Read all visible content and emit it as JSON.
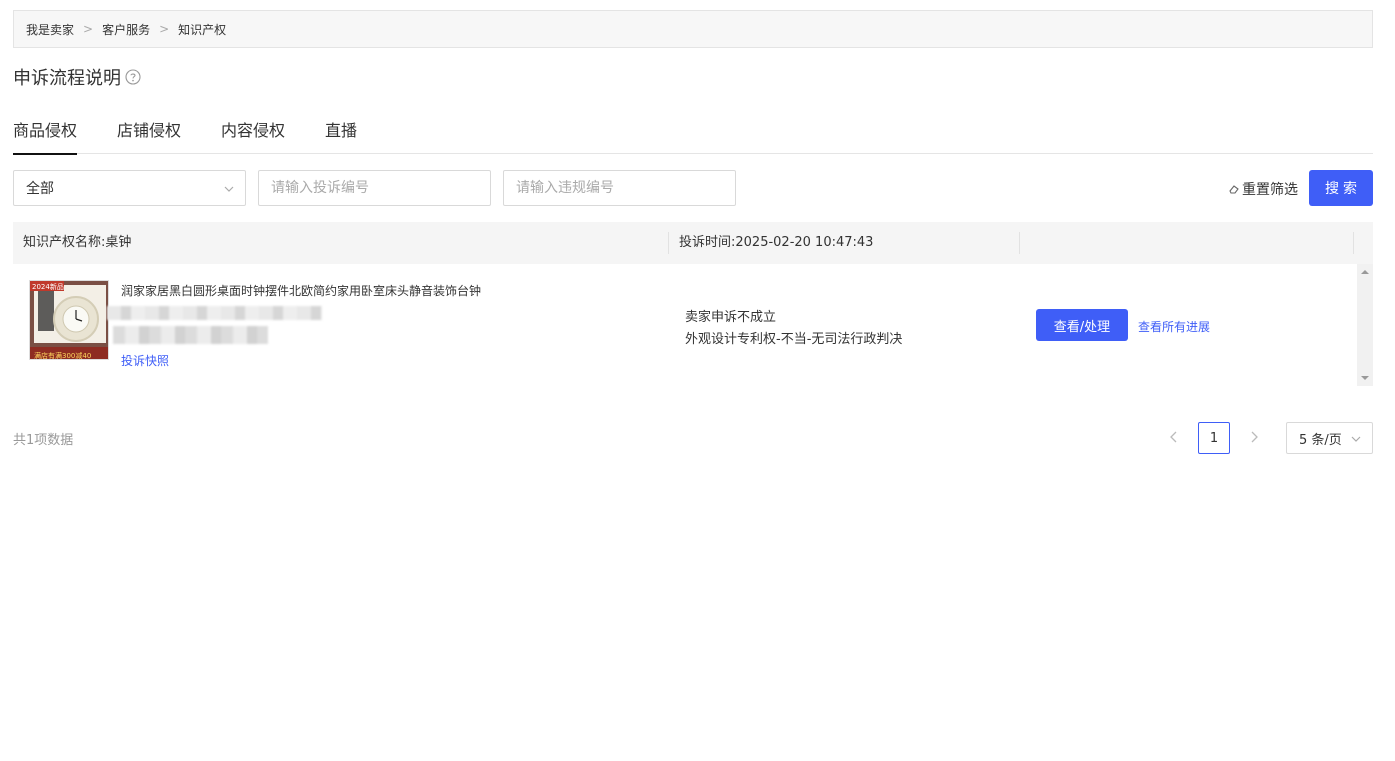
{
  "breadcrumb": {
    "items": [
      "我是卖家",
      "客户服务",
      "知识产权"
    ],
    "separator": ">"
  },
  "page": {
    "title": "申诉流程说明"
  },
  "tabs": [
    {
      "label": "商品侵权",
      "active": true
    },
    {
      "label": "店铺侵权",
      "active": false
    },
    {
      "label": "内容侵权",
      "active": false
    },
    {
      "label": "直播",
      "active": false
    }
  ],
  "filters": {
    "status_select": "全部",
    "complaint_no_placeholder": "请输入投诉编号",
    "violation_no_placeholder": "请输入违规编号",
    "reset_label": "重置筛选",
    "search_label": "搜索"
  },
  "table": {
    "header": {
      "ip_name": "知识产权名称:桌钟",
      "complaint_time": "投诉时间:2025-02-20 10:47:43"
    },
    "rows": [
      {
        "product_title": "润家家居黑白圆形桌面时钟摆件北欧简约家用卧室床头静音装饰台钟",
        "evidence_link": "投诉快照",
        "status_line1": "卖家申诉不成立",
        "status_line2": "外观设计专利权-不当-无司法行政判决",
        "action_button": "查看/处理",
        "progress_link": "查看所有进展",
        "thumb_tag": "2024新品",
        "thumb_banner": "满店有满300减40"
      }
    ]
  },
  "pagination": {
    "total_text": "共1项数据",
    "current_page": "1",
    "page_size": "5 条/页"
  },
  "colors": {
    "primary": "#3f5ef7",
    "header_bg": "#f5f5f5",
    "text": "#333333",
    "muted": "#999999"
  }
}
